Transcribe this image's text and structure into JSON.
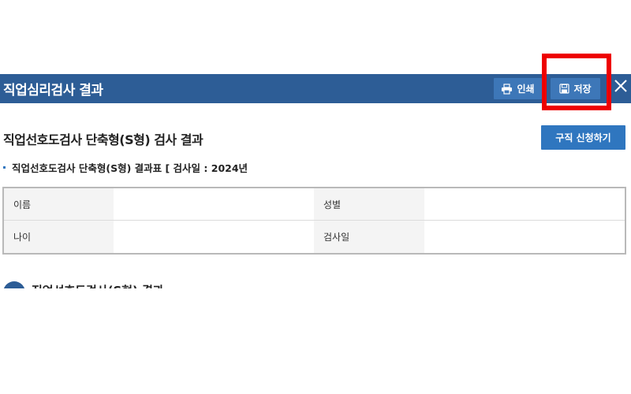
{
  "window": {
    "title": "직업심리검사 결과",
    "print_label": "인쇄",
    "save_label": "저장"
  },
  "result": {
    "title": "직업선호도검사 단축형(S형) 검사 결과",
    "apply_label": "구직 신청하기",
    "subtitle": "직업선호도검사 단축형(S형) 결과표 [ 검사일 : 2024년"
  },
  "info_table": {
    "name_label": "이름",
    "gender_label": "성별",
    "age_label": "나이",
    "test_date_label": "검사일",
    "name_value": "",
    "gender_value": "",
    "age_value": "",
    "test_date_value": ""
  },
  "next_section": {
    "title": "직업선호도검사(S형) 결과"
  },
  "colors": {
    "title_bar": "#2d5d96",
    "button": "#3d77b8",
    "apply_button": "#2f76bf",
    "highlight": "#ee0000"
  }
}
